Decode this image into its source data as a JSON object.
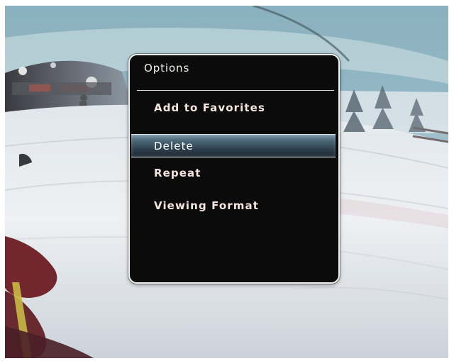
{
  "menu": {
    "title": "Options",
    "items": [
      {
        "label": "Add to Favorites",
        "selected": false
      },
      {
        "label": "Delete",
        "selected": true
      },
      {
        "label": "Repeat",
        "selected": false
      },
      {
        "label": "Viewing Format",
        "selected": false
      }
    ]
  },
  "colors": {
    "menu_background": "#0b0b0b",
    "menu_border": "#f2f2f2",
    "highlight": "#4f6a7c",
    "text": "#f6e6df"
  }
}
